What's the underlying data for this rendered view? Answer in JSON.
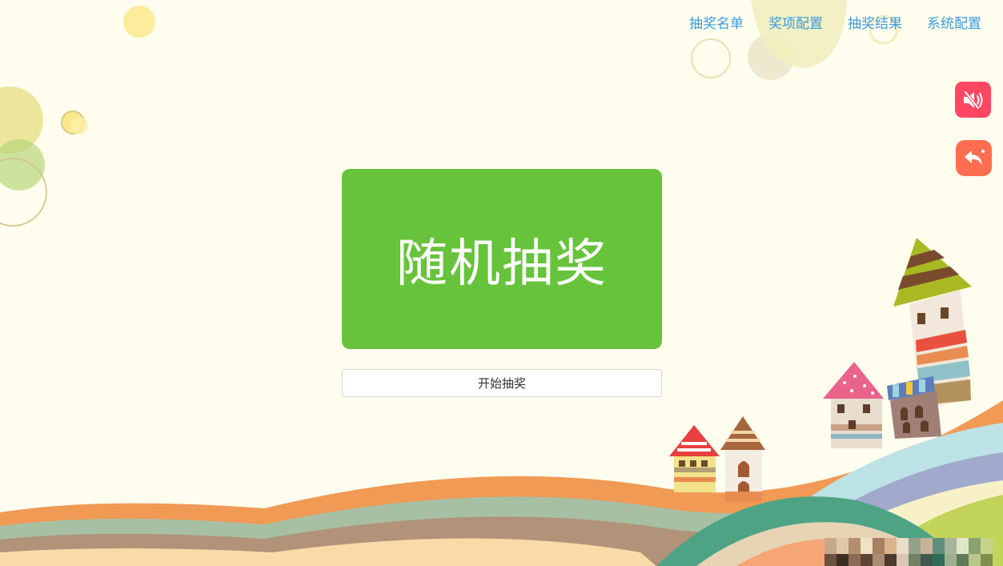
{
  "nav": {
    "items": [
      "抽奖名单",
      "奖项配置",
      "抽奖结果",
      "系统配置"
    ]
  },
  "side_buttons": {
    "mute_icon": "speaker-muted-icon",
    "back_icon": "reply-arrow-icon"
  },
  "panel": {
    "title": "随机抽奖",
    "start_label": "开始抽奖"
  },
  "colors": {
    "background": "#fffdee",
    "nav_link": "#3d9be0",
    "panel_green": "#67c33b",
    "mute_button": "#ff4763",
    "back_button": "#ff6e4f"
  }
}
